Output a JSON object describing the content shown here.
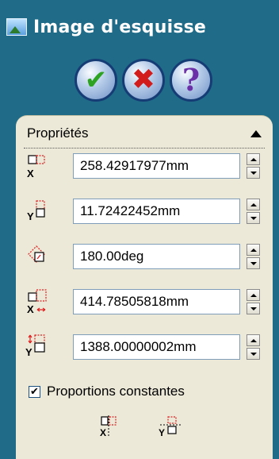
{
  "window": {
    "title": "Image d'esquisse"
  },
  "actions": {
    "ok": "OK",
    "cancel": "Annuler",
    "help": "?"
  },
  "properties": {
    "header": "Propriétés",
    "fields": [
      {
        "icon": "x-position-icon",
        "value": "258.42917977mm"
      },
      {
        "icon": "y-position-icon",
        "value": "11.72422452mm"
      },
      {
        "icon": "rotation-icon",
        "value": "180.00deg"
      },
      {
        "icon": "width-icon",
        "value": "414.78505818mm"
      },
      {
        "icon": "height-icon",
        "value": "1388.00000002mm"
      }
    ],
    "checkbox": {
      "label": "Proportions constantes",
      "checked": true
    }
  },
  "colors": {
    "background": "#1f6b88",
    "panel": "#ece9d8",
    "accent_red": "#e02020"
  }
}
